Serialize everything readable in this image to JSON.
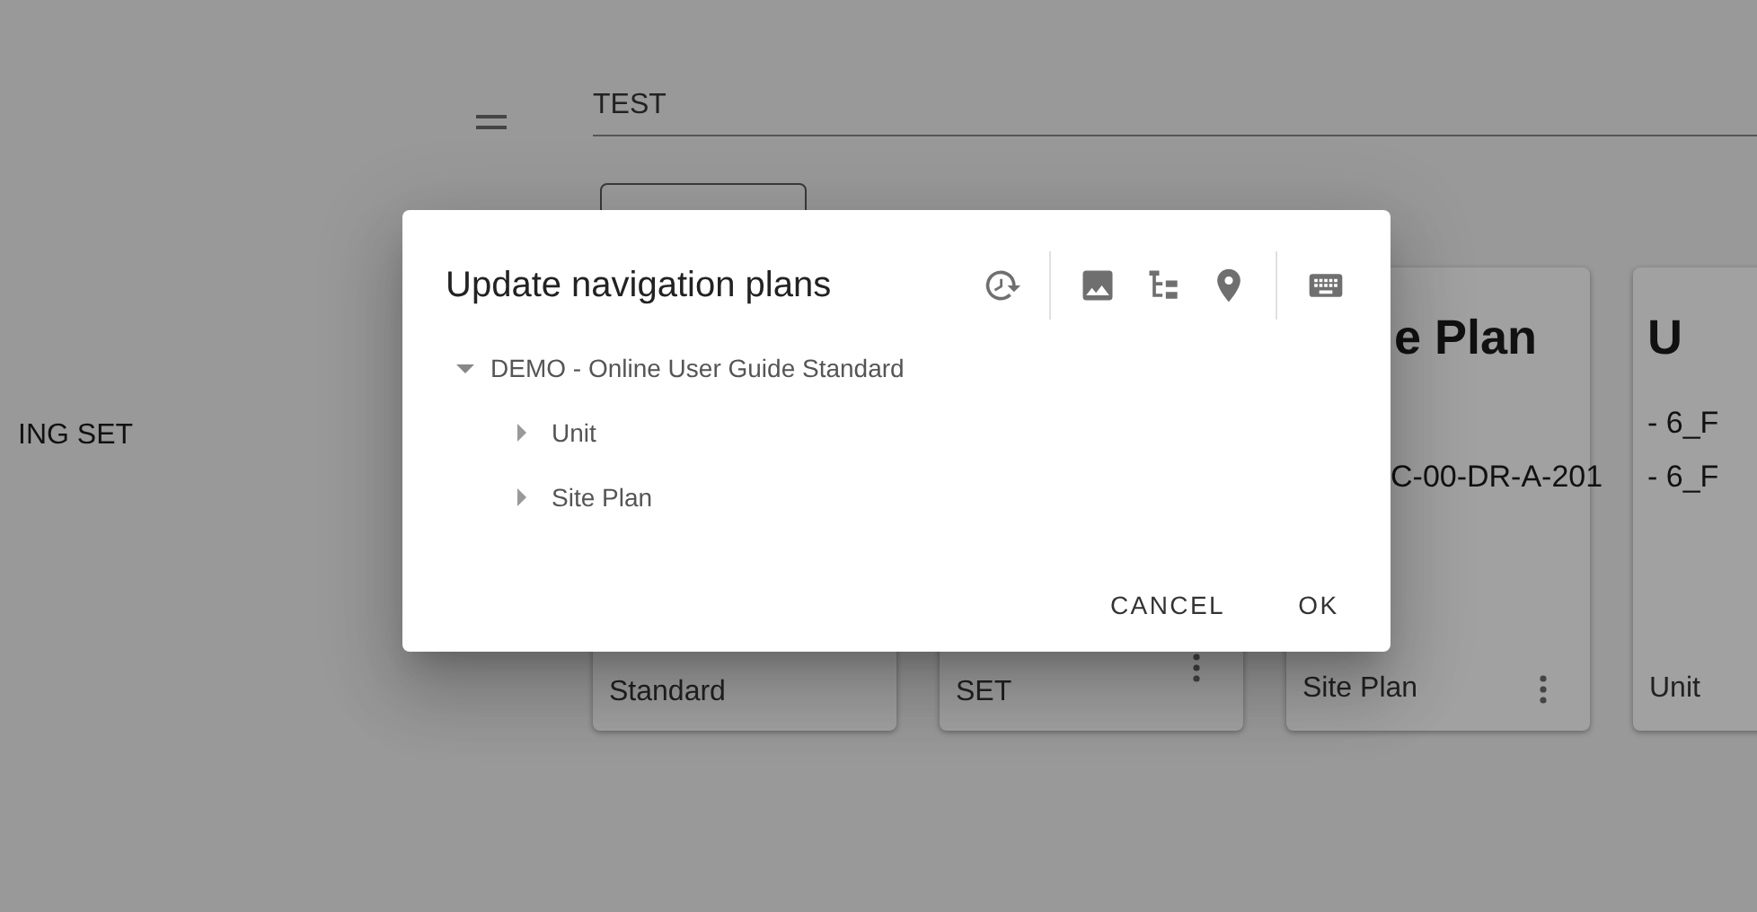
{
  "background": {
    "search_field": {
      "value": "TEST"
    },
    "sidebar_text": "ING SET",
    "cards": [
      {
        "title": "Standard"
      },
      {
        "title": "SET",
        "menu": true
      },
      {
        "heading": "e Plan",
        "lines": [
          "C-00-DR-A-201"
        ],
        "title": "Site Plan",
        "menu": true
      },
      {
        "heading": "U",
        "lines": [
          "- 6_F",
          "- 6_F"
        ],
        "title": "Unit",
        "menu": false
      }
    ]
  },
  "dialog": {
    "title": "Update navigation plans",
    "tree": [
      {
        "label": "DEMO - Online User Guide Standard",
        "expanded": true,
        "children": [
          {
            "label": "Unit",
            "expanded": false
          },
          {
            "label": "Site Plan",
            "expanded": false
          }
        ]
      }
    ],
    "buttons": [
      "CANCEL",
      "OK"
    ]
  }
}
